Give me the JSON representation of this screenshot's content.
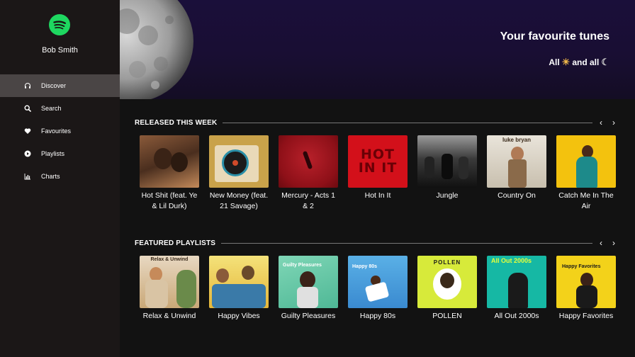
{
  "user": {
    "name": "Bob Smith"
  },
  "nav": [
    {
      "label": "Discover",
      "icon": "headphones-icon",
      "active": true
    },
    {
      "label": "Search",
      "icon": "search-icon",
      "active": false
    },
    {
      "label": "Favourites",
      "icon": "heart-icon",
      "active": false
    },
    {
      "label": "Playlists",
      "icon": "play-circle-icon",
      "active": false
    },
    {
      "label": "Charts",
      "icon": "bar-chart-icon",
      "active": false
    }
  ],
  "hero": {
    "title": "Your favourite tunes",
    "sub_prefix": "All",
    "sub_middle": "and all",
    "sun_glyph": "☀",
    "moon_glyph": "☾"
  },
  "released": {
    "title": "RELEASED THIS WEEK",
    "prev": "‹",
    "next": "›",
    "items": [
      {
        "title": "Hot Shit (feat. Ye & Lil Durk)",
        "cover_text": ""
      },
      {
        "title": "New Money (feat. 21 Savage)",
        "cover_text": ""
      },
      {
        "title": "Mercury - Acts 1 & 2",
        "cover_text": ""
      },
      {
        "title": "Hot In It",
        "cover_text": "HOT IN IT"
      },
      {
        "title": "Jungle",
        "cover_text": ""
      },
      {
        "title": "Country On",
        "cover_text": "luke bryan"
      },
      {
        "title": "Catch Me In The Air",
        "cover_text": ""
      }
    ]
  },
  "featured": {
    "title": "FEATURED PLAYLISTS",
    "prev": "‹",
    "next": "›",
    "items": [
      {
        "title": "Relax & Unwind",
        "cover_text": "Relax & Unwind"
      },
      {
        "title": "Happy Vibes",
        "cover_text": ""
      },
      {
        "title": "Guilty Pleasures",
        "cover_text": "Guilty Pleasures"
      },
      {
        "title": "Happy 80s",
        "cover_text": "Happy 80s"
      },
      {
        "title": "POLLEN",
        "cover_text": "POLLEN"
      },
      {
        "title": "All Out 2000s",
        "cover_text": "All Out 2000s"
      },
      {
        "title": "Happy Favorites",
        "cover_text": "Happy Favorites"
      }
    ]
  },
  "colors": {
    "brand": "#1ed760",
    "sidebar": "#1b1717",
    "active": "#4a4545",
    "bg": "#121212"
  }
}
